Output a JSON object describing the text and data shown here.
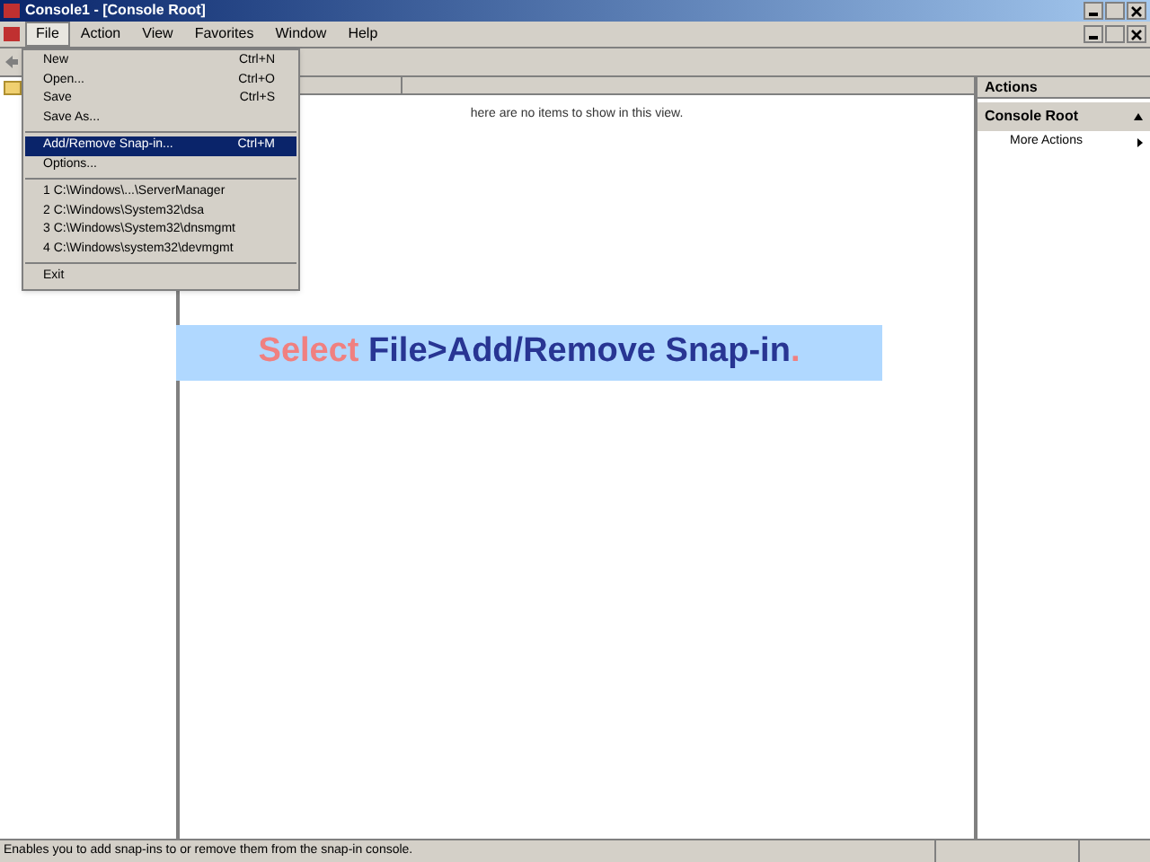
{
  "window": {
    "title": "Console1 - [Console Root]"
  },
  "menubar": [
    {
      "label": "File",
      "selected": true
    },
    {
      "label": "Action",
      "selected": false
    },
    {
      "label": "View",
      "selected": false
    },
    {
      "label": "Favorites",
      "selected": false
    },
    {
      "label": "Window",
      "selected": false
    },
    {
      "label": "Help",
      "selected": false
    }
  ],
  "file_menu": {
    "sections": [
      [
        {
          "label": "New",
          "shortcut": "Ctrl+N",
          "selected": false
        },
        {
          "label": "Open...",
          "shortcut": "Ctrl+O",
          "selected": false
        },
        {
          "label": "Save",
          "shortcut": "Ctrl+S",
          "selected": false
        },
        {
          "label": "Save As...",
          "selected": false
        }
      ],
      [
        {
          "label": "Add/Remove Snap-in...",
          "shortcut": "Ctrl+M",
          "selected": true
        },
        {
          "label": "Options...",
          "selected": false
        }
      ],
      [
        {
          "label": "1 C:\\Windows\\...\\ServerManager",
          "selected": false
        },
        {
          "label": "2 C:\\Windows\\System32\\dsa",
          "selected": false
        },
        {
          "label": "3 C:\\Windows\\System32\\dnsmgmt",
          "selected": false
        },
        {
          "label": "4 C:\\Windows\\system32\\devmgmt",
          "selected": false
        }
      ],
      [
        {
          "label": "Exit",
          "selected": false
        }
      ]
    ]
  },
  "list_view": {
    "empty_message": "here are no items to show in this view."
  },
  "actions_pane": {
    "title": "Actions",
    "section": "Console Root",
    "items": [
      "More Actions"
    ]
  },
  "callout": {
    "parts": [
      {
        "text": "Select ",
        "kind": "highlight"
      },
      {
        "text": "File>Add/Remove Snap-in",
        "kind": "plain"
      },
      {
        "text": ".",
        "kind": "highlight"
      }
    ]
  },
  "status_bar": {
    "text": "Enables you to add snap-ins to or remove them from the snap-in console."
  }
}
